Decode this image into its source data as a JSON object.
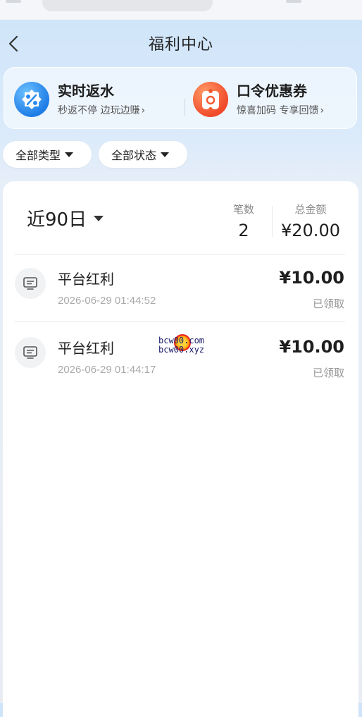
{
  "header": {
    "title": "福利中心"
  },
  "promos": [
    {
      "title": "实时返水",
      "subtitle": "秒返不停 边玩边赚",
      "chevron": "›",
      "icon": "percent-badge-icon",
      "color": "#2a8af0"
    },
    {
      "title": "口令优惠券",
      "subtitle": "惊喜加码 专享回馈",
      "chevron": "›",
      "icon": "coupon-icon",
      "color": "#f45a32"
    }
  ],
  "filters": {
    "type_label": "全部类型",
    "status_label": "全部状态"
  },
  "summary": {
    "period_label": "近90日",
    "count_label": "笔数",
    "count_value": "2",
    "total_label": "总金额",
    "total_value": "¥20.00"
  },
  "records": [
    {
      "title": "平台红利",
      "time": "2026-06-29 01:44:52",
      "amount": "¥10.00",
      "status": "已领取"
    },
    {
      "title": "平台红利",
      "time": "2026-06-29 01:44:17",
      "amount": "¥10.00",
      "status": "已领取"
    }
  ],
  "watermark": {
    "line1": "bcw00.com",
    "line2": "bcw00.xyz"
  }
}
